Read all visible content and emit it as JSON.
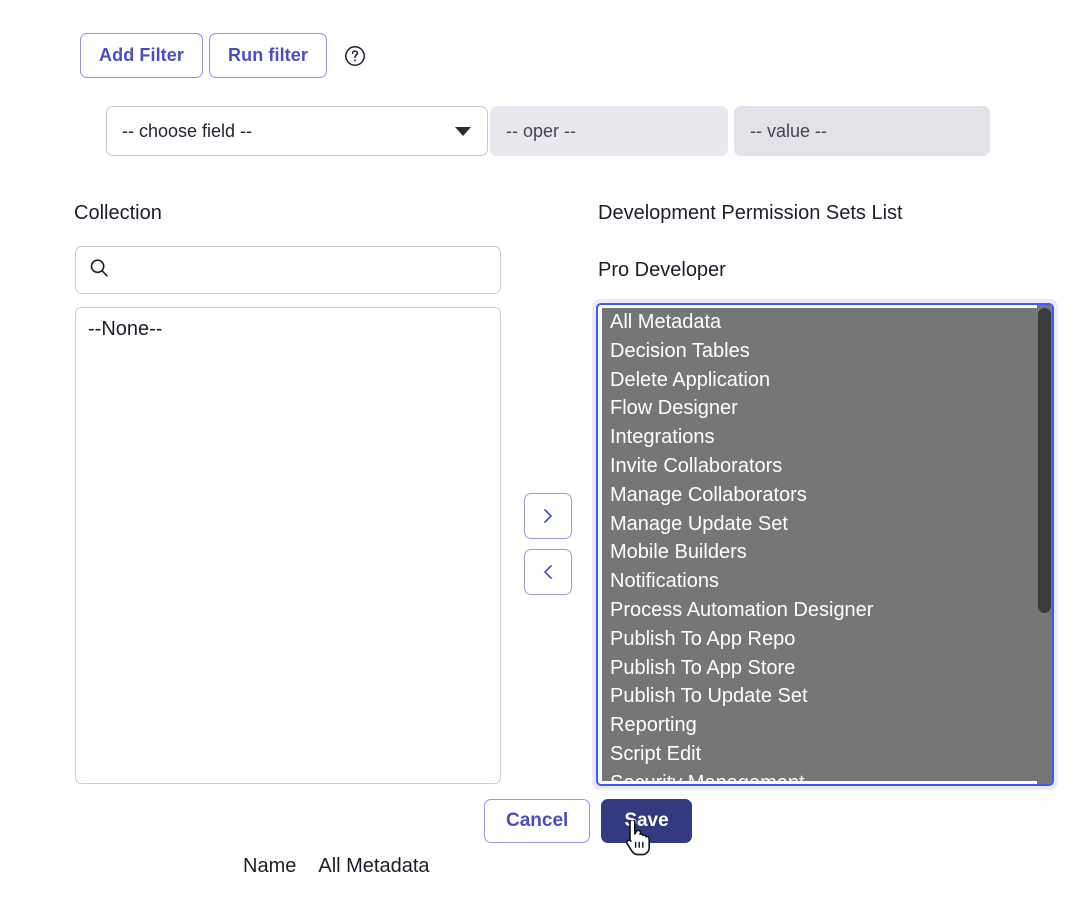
{
  "toolbar": {
    "add_filter_label": "Add Filter",
    "run_filter_label": "Run filter",
    "help_icon": "question-circle-icon"
  },
  "filter_row": {
    "field_value": "-- choose field --",
    "field_caret_icon": "chevron-down-icon",
    "oper_value": "-- oper --",
    "value_value": "-- value --"
  },
  "left_panel": {
    "label": "Collection",
    "search": {
      "icon": "search-icon",
      "value": "",
      "placeholder": ""
    },
    "options": [
      "--None--"
    ]
  },
  "transfer": {
    "move_right_label": "›",
    "move_left_label": "‹",
    "move_right_icon": "chevron-right-icon",
    "move_left_icon": "chevron-left-icon"
  },
  "right_panel": {
    "label": "Development Permission Sets List",
    "sublabel": "Pro Developer",
    "options": [
      "All Metadata",
      "Decision Tables",
      "Delete Application",
      "Flow Designer",
      "Integrations",
      "Invite Collaborators",
      "Manage Collaborators",
      "Manage Update Set",
      "Mobile Builders",
      "Notifications",
      "Process Automation Designer",
      "Publish To App Repo",
      "Publish To App Store",
      "Publish To Update Set",
      "Reporting",
      "Script Edit",
      "Security Management"
    ]
  },
  "footer": {
    "cancel_label": "Cancel",
    "save_label": "Save"
  },
  "record": {
    "name_label": "Name",
    "name_value": "All Metadata"
  },
  "colors": {
    "accent": "#4a4ec0",
    "save_bg": "#343a82",
    "focus_ring": "#3b5bfd",
    "selected_list_bg": "#767676",
    "filter_cell_bg": "#e8e9ee"
  }
}
